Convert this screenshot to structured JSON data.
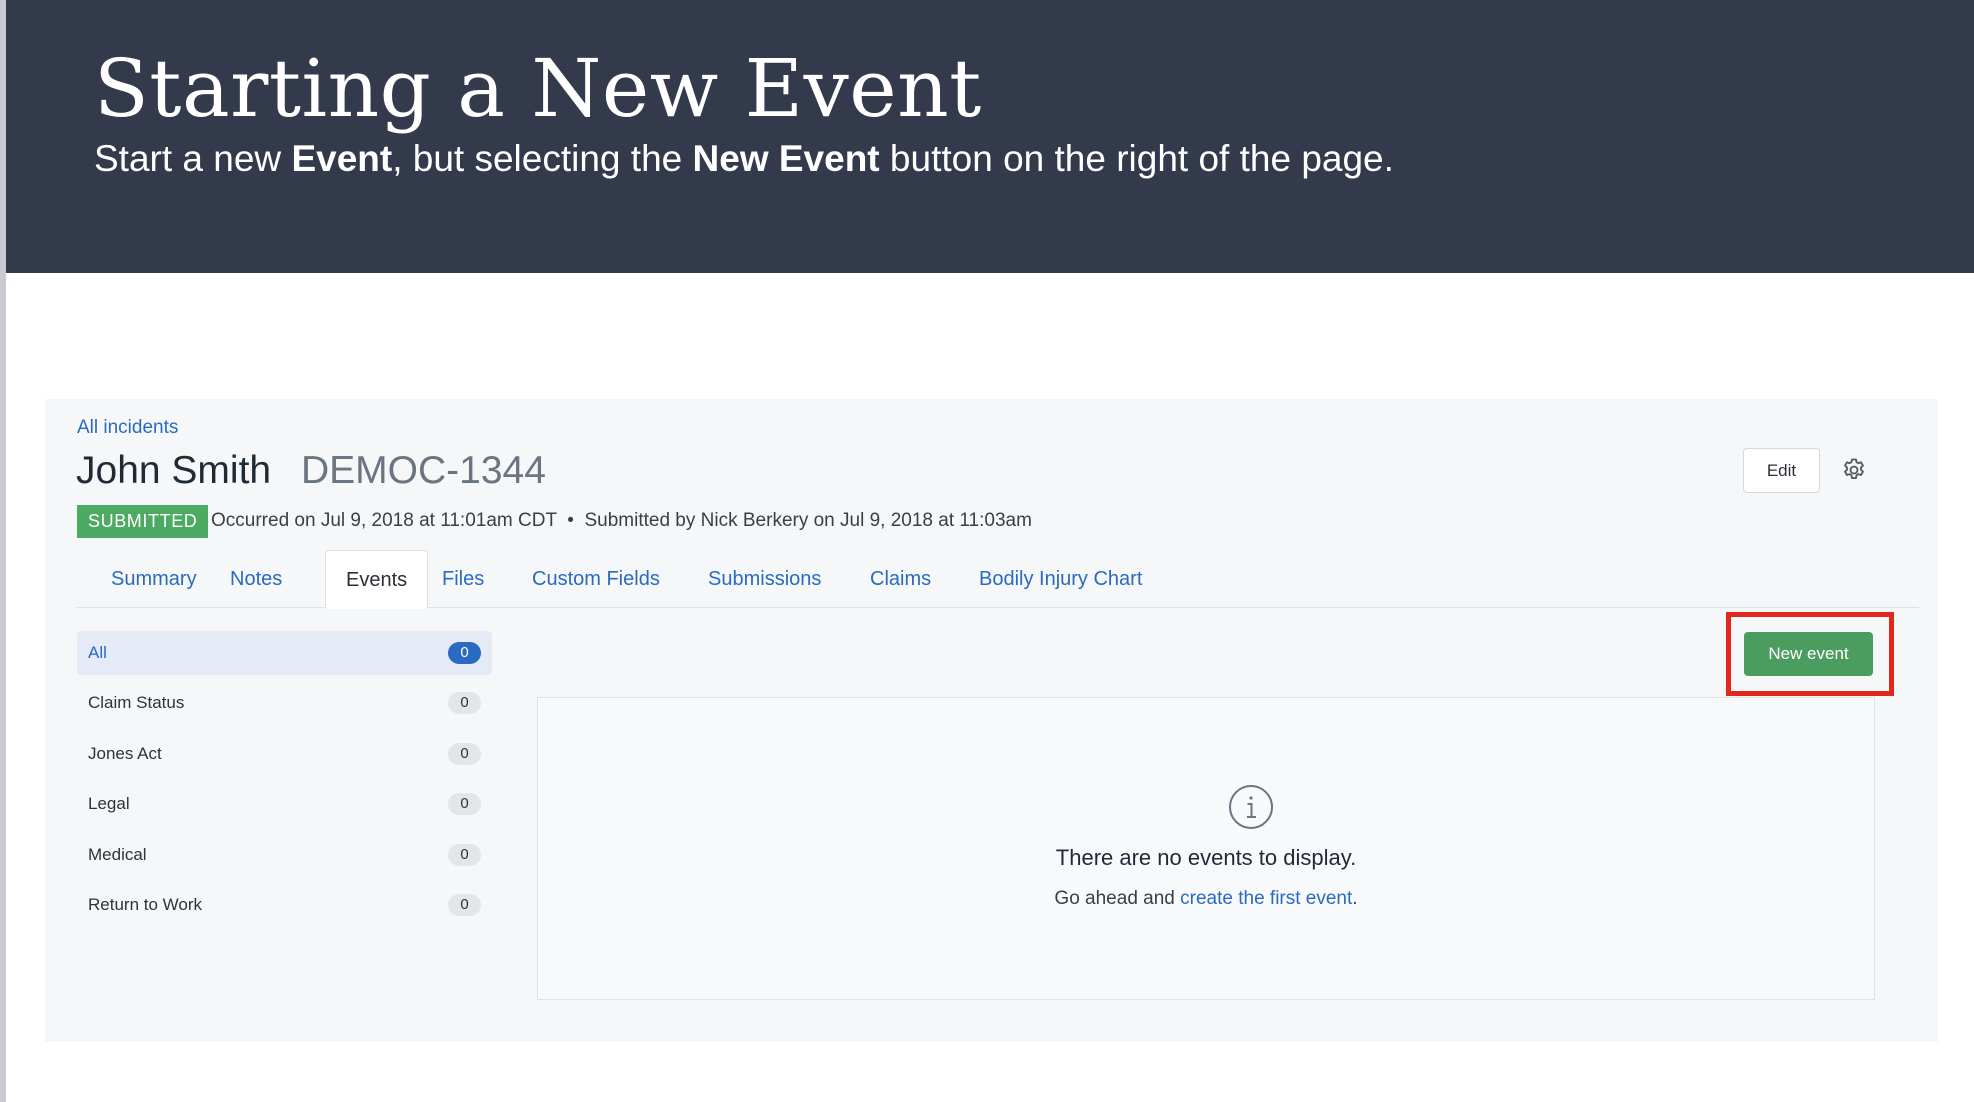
{
  "banner": {
    "title": "Starting a New Event",
    "subtitle_parts": [
      "Start a new ",
      "Event",
      ", but selecting the ",
      "New Event",
      " button on the right of the page."
    ]
  },
  "incident": {
    "breadcrumb": "All incidents",
    "person_name": "John Smith",
    "incident_id": "DEMOC-1344",
    "status": "SUBMITTED",
    "occurred": "Occurred on Jul 9, 2018 at 11:01am CDT",
    "separator": "•",
    "submitted": "Submitted by Nick Berkery on Jul 9, 2018 at 11:03am",
    "edit_label": "Edit"
  },
  "tabs": [
    {
      "label": "Summary",
      "active": false
    },
    {
      "label": "Notes",
      "active": false
    },
    {
      "label": "Events",
      "active": true
    },
    {
      "label": "Files",
      "active": false
    },
    {
      "label": "Custom Fields",
      "active": false
    },
    {
      "label": "Submissions",
      "active": false
    },
    {
      "label": "Claims",
      "active": false
    },
    {
      "label": "Bodily Injury Chart",
      "active": false
    }
  ],
  "categories": [
    {
      "label": "All",
      "count": "0",
      "active": true
    },
    {
      "label": "Claim Status",
      "count": "0",
      "active": false
    },
    {
      "label": "Jones Act",
      "count": "0",
      "active": false
    },
    {
      "label": "Legal",
      "count": "0",
      "active": false
    },
    {
      "label": "Medical",
      "count": "0",
      "active": false
    },
    {
      "label": "Return to Work",
      "count": "0",
      "active": false
    }
  ],
  "new_event_label": "New event",
  "empty_state": {
    "title": "There are no events to display.",
    "body_prefix": "Go ahead and ",
    "link_text": "create the first event",
    "body_suffix": "."
  },
  "colors": {
    "banner_bg": "#333a4c",
    "link_blue": "#2a6ac1",
    "submitted_green": "#4caa62",
    "button_green": "#4b9c5f",
    "highlight_red": "#e0281c"
  },
  "icons": [
    "gear-icon",
    "info-icon"
  ]
}
